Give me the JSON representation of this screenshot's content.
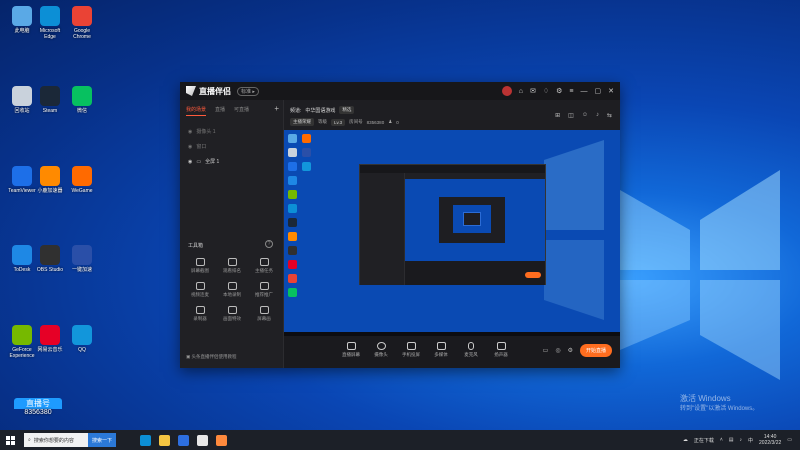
{
  "desktop": {
    "icons": [
      {
        "label": "此电脑",
        "color": "#5aa9e6"
      },
      {
        "label": "回收站",
        "color": "#c9d2dc"
      },
      {
        "label": "TeamViewer",
        "color": "#1d6fe8"
      },
      {
        "label": "ToDesk",
        "color": "#1e88e5"
      },
      {
        "label": "GeForce Experience",
        "color": "#76b900"
      },
      {
        "label": "Microsoft Edge",
        "color": "#0c8fd6"
      },
      {
        "label": "Steam",
        "color": "#1b2838"
      },
      {
        "label": "小鹿加速器",
        "color": "#ff8a00"
      },
      {
        "label": "OBS Studio",
        "color": "#303030"
      },
      {
        "label": "网易云音乐",
        "color": "#e60026"
      },
      {
        "label": "Google Chrome",
        "color": "#ea4335"
      },
      {
        "label": "微信",
        "color": "#07c160"
      },
      {
        "label": "WeGame",
        "color": "#ff6a00"
      },
      {
        "label": "一键加速",
        "color": "#2a4fa8"
      },
      {
        "label": "QQ",
        "color": "#1296db"
      }
    ],
    "activation_line1": "激活 Windows",
    "activation_line2": "转到\"设置\"以激活 Windows。",
    "badge_title": "直播号",
    "badge_number": "8356380"
  },
  "app": {
    "title": "直播伴侣",
    "version_badge": "标准 ▸",
    "left_tabs": [
      "我的场景",
      "直播",
      "可直播"
    ],
    "scenes": [
      {
        "label": "摄像头 1"
      },
      {
        "label": "窗口"
      },
      {
        "label": "全屏 1"
      }
    ],
    "tools_title": "工具箱",
    "tools_help": "?",
    "tools": [
      "屏幕截图",
      "观看排名",
      "主播任务",
      "视频连麦",
      "本地录制",
      "推荐推广",
      "录制器",
      "画面特效",
      "屏幕画"
    ],
    "footer_notice": "头条直播伴侣使用教程",
    "info": {
      "channel_label": "频道:",
      "channel_name": "中华国语游戏",
      "status_pill": "精选",
      "tag1": "主播荣耀",
      "tag2": "等级",
      "tag3": "Lv.3",
      "room_label": "房间号",
      "room_id": "8356380",
      "fans": "0"
    },
    "bottom_tools": [
      "直播屏幕",
      "摄像头",
      "手机投屏",
      "多媒体",
      "麦克风",
      "扬声器"
    ],
    "go_live_label": "开始直播"
  },
  "taskbar": {
    "search_placeholder": "搜索你想要的内容",
    "search_button": "搜索一下",
    "tray_text": "正在下载",
    "time": "14:40",
    "date": "2022/3/22"
  }
}
